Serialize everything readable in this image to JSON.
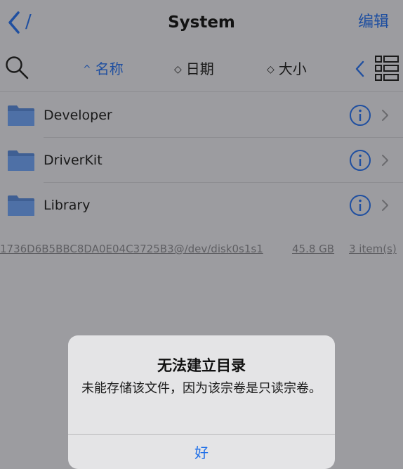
{
  "nav": {
    "back_label": "/",
    "title": "System",
    "edit_label": "编辑"
  },
  "sortbar": {
    "name_label": "名称",
    "name_arrow": "^",
    "date_label": "日期",
    "date_arrow": "◇",
    "size_label": "大小",
    "size_arrow": "◇"
  },
  "files": [
    {
      "name": "Developer",
      "icon": "folder-icon"
    },
    {
      "name": "DriverKit",
      "icon": "folder-icon"
    },
    {
      "name": "Library",
      "icon": "folder-icon"
    }
  ],
  "status": {
    "volume": "1736D6B5BBC8DA0E04C3725B3@/dev/disk0s1s1",
    "size": "45.8 GB",
    "count": "3 item(s)"
  },
  "dialog": {
    "title": "无法建立目录",
    "message": "未能存储该文件，因为该宗卷是只读宗卷。",
    "button": "好"
  },
  "colors": {
    "accent": "#1f4fa0",
    "folder": "#4a6a9e",
    "background": "#9c9ca0",
    "dialog": "#e4e4e6"
  }
}
